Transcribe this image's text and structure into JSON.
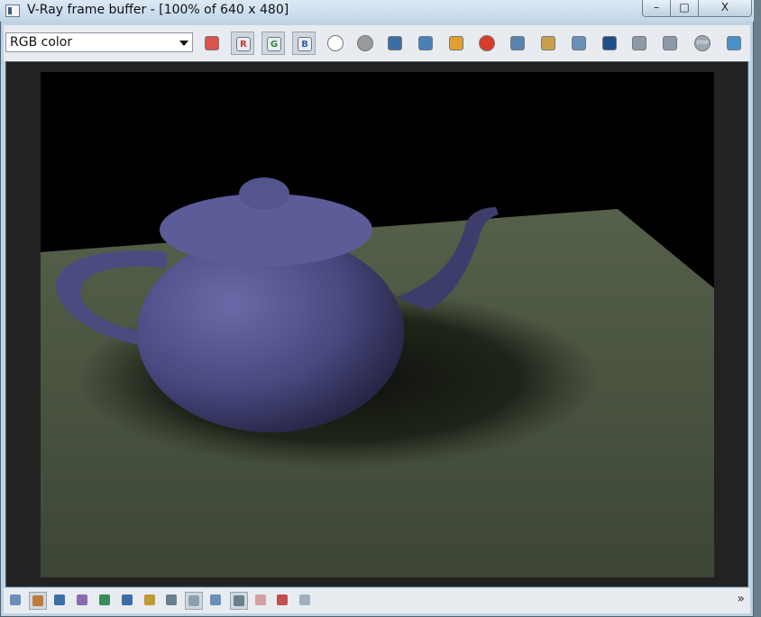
{
  "window": {
    "title": "V-Ray frame buffer - [100% of 640 x 480]",
    "minimize_label": "–",
    "maximize_label": "□",
    "close_label": "X"
  },
  "toolbar": {
    "channel_select": {
      "value": "RGB color"
    },
    "icons": [
      {
        "name": "color-channels-icon",
        "label": "",
        "color": "#d9534f",
        "pressed": false
      },
      {
        "name": "red-channel-toggle-icon",
        "label": "R",
        "color": "#c0392b",
        "pressed": true
      },
      {
        "name": "green-channel-toggle-icon",
        "label": "G",
        "color": "#2e8b3a",
        "pressed": true
      },
      {
        "name": "blue-channel-toggle-icon",
        "label": "B",
        "color": "#2f5fae",
        "pressed": true
      },
      {
        "name": "white-circle-icon",
        "label": "",
        "color": "#ffffff",
        "pressed": false
      },
      {
        "name": "gray-circle-icon",
        "label": "",
        "color": "#9a9a9a",
        "pressed": false
      },
      {
        "name": "save-image-icon",
        "label": "",
        "color": "#3a6ea5",
        "pressed": false
      },
      {
        "name": "save-all-icon",
        "label": "",
        "color": "#4a7fb8",
        "pressed": false
      },
      {
        "name": "open-folder-icon",
        "label": "",
        "color": "#e0a030",
        "pressed": false
      },
      {
        "name": "clear-image-icon",
        "label": "",
        "color": "#d93a2b",
        "pressed": false
      },
      {
        "name": "duplicate-to-mtl-icon",
        "label": "",
        "color": "#5a84b0",
        "pressed": false
      },
      {
        "name": "track-mouse-icon",
        "label": "",
        "color": "#c9a04a",
        "pressed": false
      },
      {
        "name": "region-render-icon",
        "label": "",
        "color": "#6a8fb8",
        "pressed": false
      },
      {
        "name": "link-to-vfb-icon",
        "label": "",
        "color": "#1f4f8a",
        "pressed": false
      },
      {
        "name": "render-last-icon",
        "label": "",
        "color": "#8a9aa8",
        "pressed": false
      },
      {
        "name": "render-region-icon",
        "label": "",
        "color": "#8a9aa8",
        "pressed": false
      },
      {
        "name": "stop-render-icon",
        "label": "STOP",
        "color": "#9aa6b0",
        "pressed": false
      },
      {
        "name": "render-icon",
        "label": "",
        "color": "#4a90c8",
        "pressed": false
      }
    ]
  },
  "statusbar": {
    "icons": [
      {
        "name": "show-pixel-info-icon",
        "color": "#6a8fb8",
        "pressed": false
      },
      {
        "name": "display-correction-icon",
        "color": "#c07a3a",
        "pressed": true
      },
      {
        "name": "info-icon",
        "color": "#3a6ea5",
        "pressed": false
      },
      {
        "name": "color-levels-icon",
        "color": "#8a6ab0",
        "pressed": false
      },
      {
        "name": "color-curve-icon",
        "color": "#3a8a5a",
        "pressed": false
      },
      {
        "name": "histogram-icon",
        "color": "#3a6ea5",
        "pressed": false
      },
      {
        "name": "exposure-icon",
        "color": "#c09a30",
        "pressed": false
      },
      {
        "name": "settings-icon",
        "color": "#6a7f8c",
        "pressed": false
      },
      {
        "name": "srgb-icon",
        "color": "#8aa0b0",
        "pressed": true
      },
      {
        "name": "lut-icon",
        "color": "#6a8fb8",
        "pressed": false
      },
      {
        "name": "hsv-icon",
        "color": "#6a7f8c",
        "pressed": true
      },
      {
        "name": "compare-icon",
        "color": "#d0a0a0",
        "pressed": false
      },
      {
        "name": "ab-compare-icon",
        "color": "#c05050",
        "pressed": false
      },
      {
        "name": "stamp-icon",
        "color": "#a0b0c0",
        "pressed": false
      }
    ],
    "expand_label": "»"
  },
  "colors": {
    "titlebar": "#c2d6e8",
    "toolbar": "#e8ecf0",
    "frame": "#222222",
    "teapot": "#4a4a7e",
    "floor": "#4a5540"
  }
}
